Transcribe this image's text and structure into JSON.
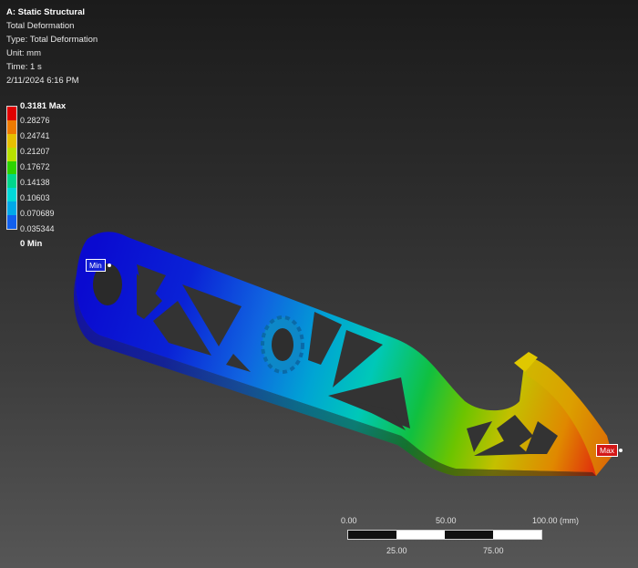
{
  "info": {
    "title": "A: Static Structural",
    "lines": [
      "Total Deformation",
      "Type: Total Deformation",
      "Unit: mm",
      "Time: 1 s",
      "2/11/2024 6:16 PM"
    ]
  },
  "legend": {
    "labels": [
      "0.3181 Max",
      "0.28276",
      "0.24741",
      "0.21207",
      "0.17672",
      "0.14138",
      "0.10603",
      "0.070689",
      "0.035344",
      "0 Min"
    ],
    "colors": [
      "#e10000",
      "#ee7a00",
      "#e6c000",
      "#b8e000",
      "#2ed200",
      "#00d78c",
      "#00d8d8",
      "#00a9e8",
      "#1160ee",
      "#0000c8"
    ]
  },
  "markers": {
    "min": "Min",
    "max": "Max"
  },
  "scale_bar": {
    "top_labels": [
      "0.00",
      "50.00",
      "100.00 (mm)"
    ],
    "bottom_labels": [
      "25.00",
      "75.00"
    ]
  }
}
